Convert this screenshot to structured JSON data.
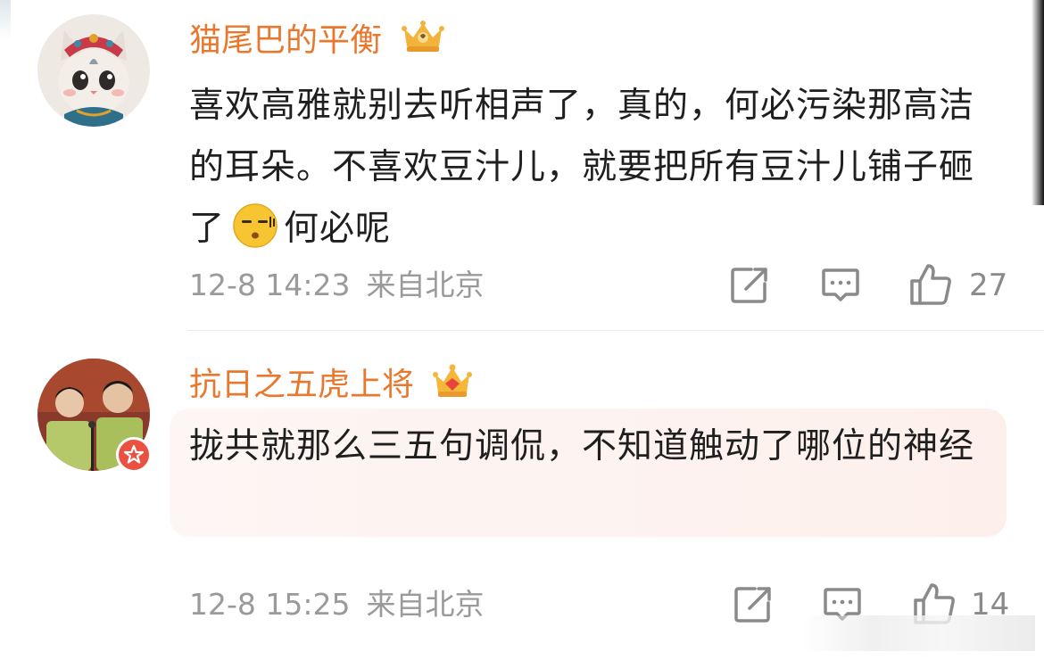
{
  "comments": [
    {
      "username": "猫尾巴的平衡",
      "badge_icon": "crown-icon",
      "text_before_emoji": "喜欢高雅就别去听相声了，真的，何必污染那高洁的耳朵。不喜欢豆汁儿，就要把所有豆汁儿铺子砸了",
      "emoji": "speechless-face-emoji",
      "text_after_emoji": "何必呢",
      "date": "12-8 14:23",
      "location": "来自北京",
      "like_count": "27"
    },
    {
      "username": "抗日之五虎上将",
      "badge_icon": "crown-icon",
      "text": "拢共就那么三五句调侃，不知道触动了哪位的神经",
      "date": "12-8 15:25",
      "location": "来自北京",
      "like_count": "14",
      "verified_badge": "star-badge"
    }
  ],
  "colors": {
    "username": "#e8782d",
    "meta": "#9a9a9a",
    "highlight_bg": "#fdf3f0",
    "verified_badge": "#ea5141"
  }
}
